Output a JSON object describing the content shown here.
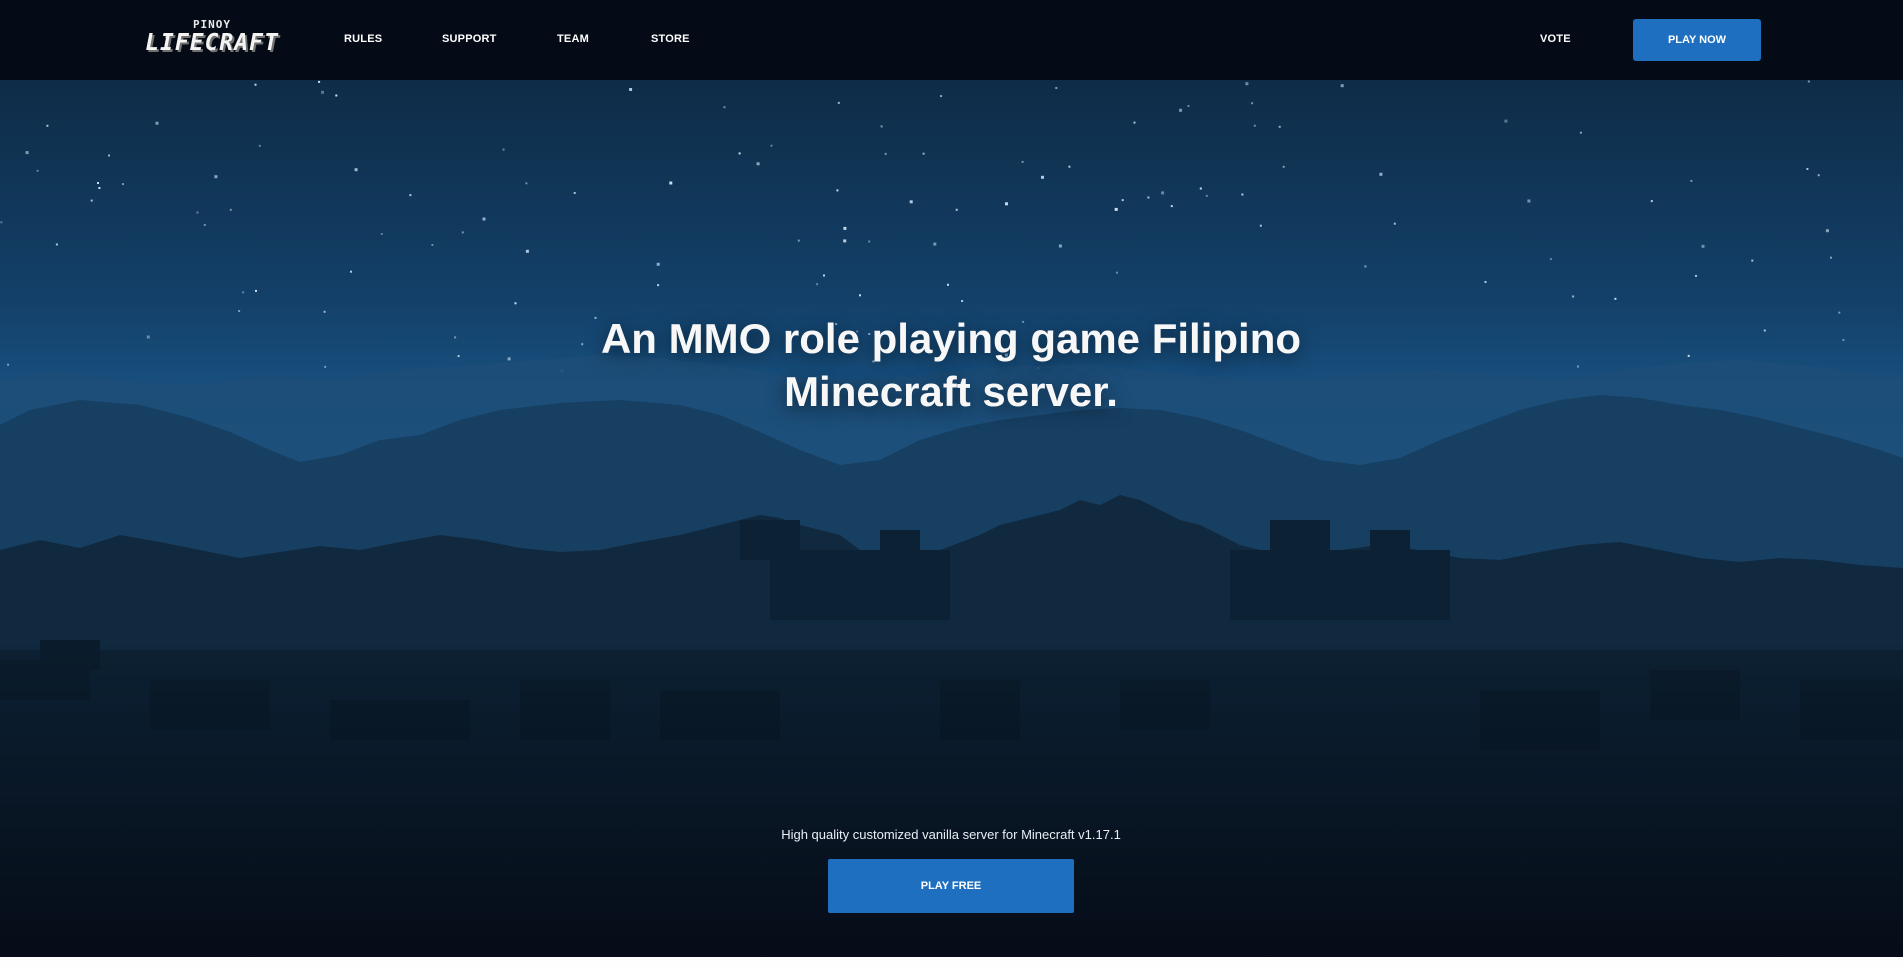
{
  "header": {
    "logo_top": "PINOY",
    "logo_main": "LIFECRAFT",
    "nav": [
      {
        "label": "RULES"
      },
      {
        "label": "SUPPORT"
      },
      {
        "label": "TEAM"
      },
      {
        "label": "STORE"
      }
    ],
    "vote_label": "VOTE",
    "play_now_label": "PLAY NOW"
  },
  "hero": {
    "headline_line1": "An MMO role playing game Filipino",
    "headline_line2": "Minecraft server.",
    "subtitle": "High quality customized vanilla server for Minecraft v1.17.1",
    "play_free_label": "PLAY FREE",
    "background": "night-forest-landscape"
  },
  "colors": {
    "header_bg": "#050b16",
    "accent": "#1f6fc0",
    "sky_top": "#0e2c47",
    "sky_mid": "#1b5a8d",
    "ground": "#07111d"
  }
}
